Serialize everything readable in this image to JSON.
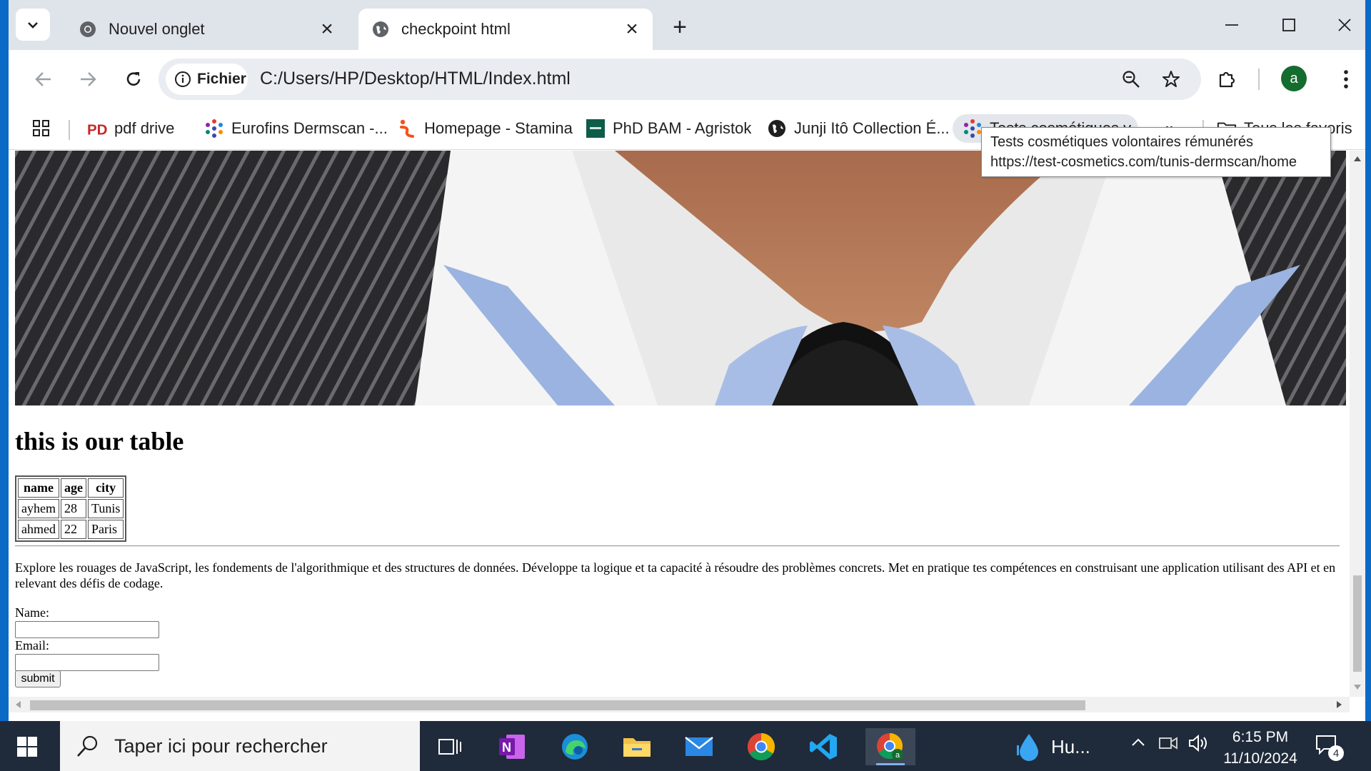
{
  "browser": {
    "tabs": [
      {
        "title": "Nouvel onglet",
        "icon": "chrome-icon",
        "active": false
      },
      {
        "title": "checkpoint html",
        "icon": "globe-icon",
        "active": true
      }
    ],
    "address": {
      "chip_label": "Fichier",
      "url": "C:/Users/HP/Desktop/HTML/Index.html"
    },
    "profile_initial": "a",
    "bookmarks": [
      {
        "label": "pdf drive",
        "icon": "pdf-drive-icon"
      },
      {
        "label": "Eurofins Dermscan -...",
        "icon": "dots-cluster-icon"
      },
      {
        "label": "Homepage - Stamina",
        "icon": "stamina-icon"
      },
      {
        "label": "PhD BAM - Agristok",
        "icon": "agristok-icon"
      },
      {
        "label": "Junji Itô Collection É...",
        "icon": "globe-dark-icon"
      },
      {
        "label": "Tests cosmétiques v...",
        "icon": "dots-cluster-icon"
      },
      {
        "label": "Tous les favoris",
        "icon": "folder-icon"
      }
    ],
    "tooltip": {
      "title": "Tests cosmétiques volontaires rémunérés",
      "url": "https://test-cosmetics.com/tunis-dermscan/home"
    }
  },
  "page": {
    "heading": "this is our table",
    "table": {
      "headers": [
        "name",
        "age",
        "city"
      ],
      "rows": [
        [
          "ayhem",
          "28",
          "Tunis"
        ],
        [
          "ahmed",
          "22",
          "Paris"
        ]
      ]
    },
    "paragraph": "Explore les rouages de JavaScript, les fondements de l'algorithmique et des structures de données. Développe ta logique et ta capacité à résoudre des problèmes concrets. Met en pratique tes compétences en construisant une application utilisant des API et en relevant des défis de codage.",
    "form": {
      "name_label": "Name:",
      "email_label": "Email:",
      "submit_label": "submit"
    }
  },
  "taskbar": {
    "search_placeholder": "Taper ici pour rechercher",
    "weather_label": "Hu...",
    "time": "6:15 PM",
    "date": "11/10/2024",
    "notification_count": "4"
  }
}
